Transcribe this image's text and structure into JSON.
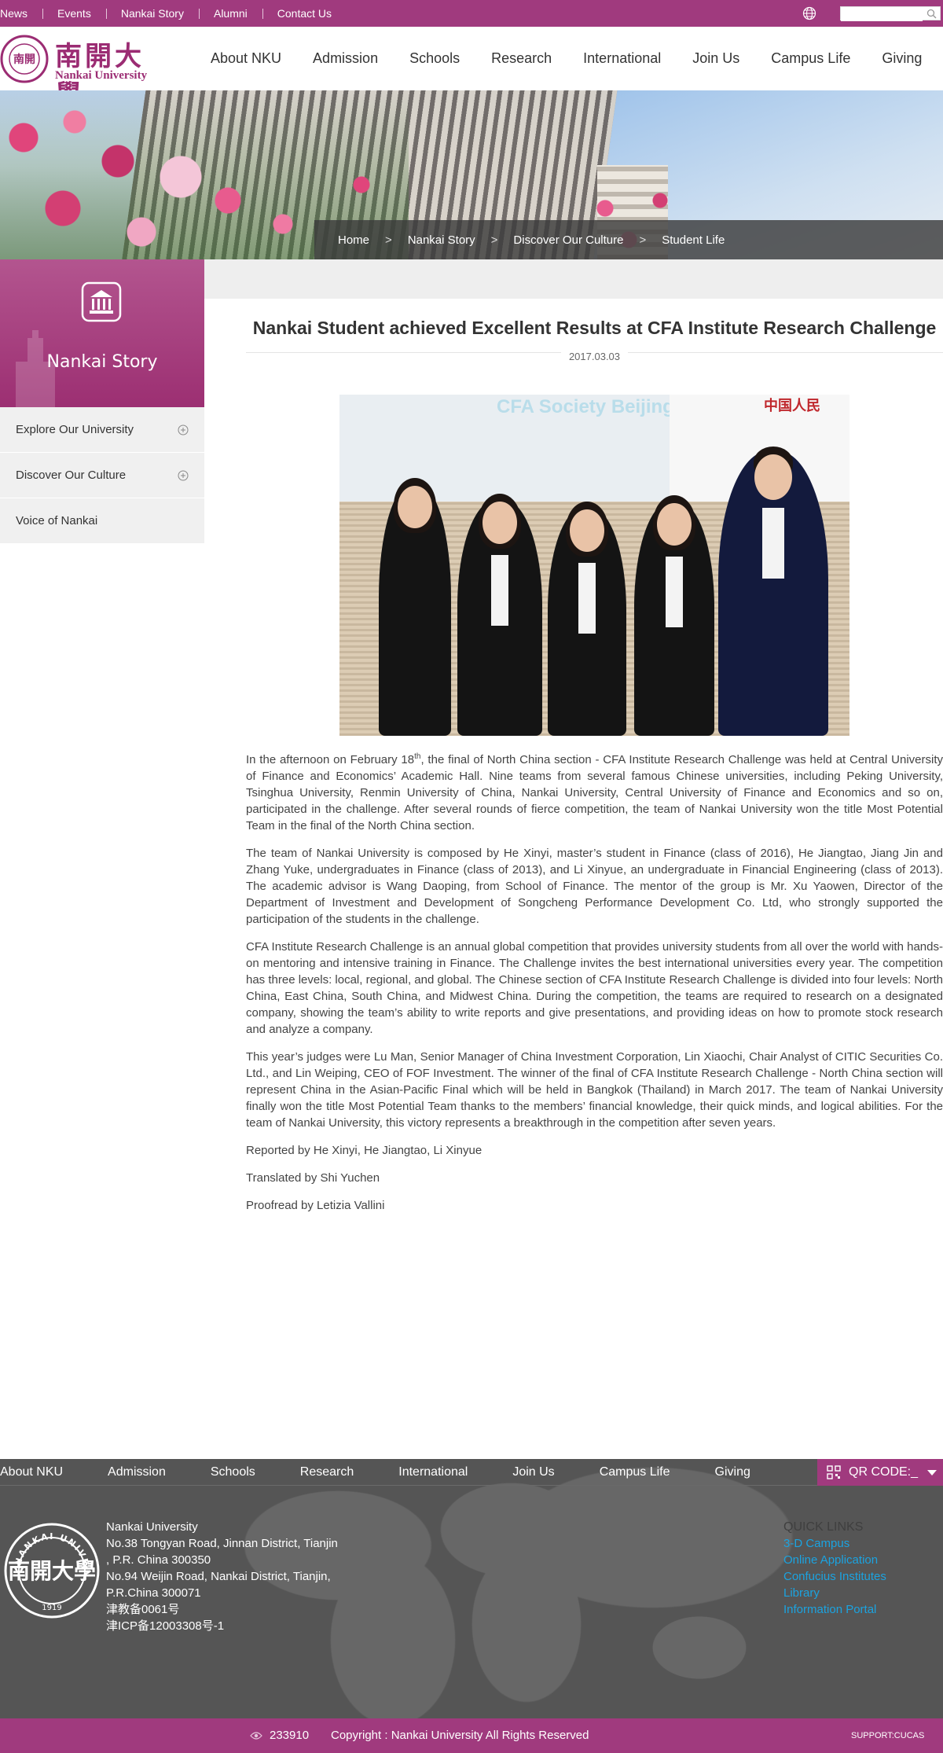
{
  "topbar": {
    "links": [
      "News",
      "Events",
      "Nankai Story",
      "Alumni",
      "Contact Us"
    ],
    "search_placeholder": ""
  },
  "logo": {
    "cn": "南開大學",
    "en": "Nankai University",
    "seal_text": "NANKAI UNIVERSITY",
    "seal_year": "1919"
  },
  "mainnav": [
    "About NKU",
    "Admission",
    "Schools",
    "Research",
    "International",
    "Join Us",
    "Campus Life",
    "Giving"
  ],
  "breadcrumb": [
    "Home",
    "Nankai Story",
    "Discover Our Culture",
    "Student Life"
  ],
  "breadcrumb_sep": ">",
  "sidebar": {
    "title": "Nankai Story",
    "items": [
      {
        "label": "Explore Our University",
        "icon": "plus-circle-icon"
      },
      {
        "label": "Discover Our Culture",
        "icon": "plus-circle-icon"
      },
      {
        "label": "Voice of Nankai"
      }
    ]
  },
  "article": {
    "title": "Nankai Student achieved Excellent Results at CFA Institute Research Challenge",
    "date": "2017.03.03",
    "photo_backdrop_text": "CFA Society Beijing",
    "photo_logo_text": "中国人民",
    "p1_pre": "In the afternoon on February 18",
    "p1_sup": "th",
    "p1_post": ", the final of North China section - CFA Institute Research Challenge was held at Central University of Finance and Economics’ Academic Hall. Nine teams from several famous Chinese universities, including Peking University, Tsinghua University, Renmin University of China, Nankai University, Central University of Finance and Economics and so on, participated in the challenge. After several rounds of fierce competition, the team of Nankai University won the title Most Potential Team in the final of the North China section.",
    "p2": "The team of Nankai University is composed by He Xinyi, master’s student in Finance (class of 2016), He Jiangtao, Jiang Jin and Zhang Yuke, undergraduates in Finance (class of 2013), and Li Xinyue, an undergraduate in Financial Engineering (class of 2013). The academic advisor is Wang Daoping, from School of Finance. The mentor of the group is Mr. Xu Yaowen, Director of the Department of Investment and Development of Songcheng Performance Development Co. Ltd, who strongly supported the participation of the students in the challenge.",
    "p3": "CFA Institute Research Challenge is an annual global competition that provides university students from all over the world with hands-on mentoring and intensive training in Finance. The Challenge invites the best international universities every year. The competition has three levels: local, regional, and global. The Chinese section of CFA Institute Research Challenge is divided into four levels: North China, East China, South China, and Midwest China. During the competition, the teams are required to research on a designated company, showing the team’s ability to write reports and give presentations, and providing ideas on how to promote stock research and analyze a company.",
    "p4": "This year’s judges were Lu Man, Senior Manager of China Investment Corporation, Lin Xiaochi, Chair Analyst of CITIC Securities Co. Ltd., and Lin Weiping, CEO of FOF Investment. The winner of the final of CFA Institute Research Challenge - North China section will represent China in the Asian-Pacific Final which will be held in Bangkok (Thailand) in March 2017. The team of Nankai University finally won the title Most Potential Team thanks to the members’ financial knowledge, their quick minds, and logical abilities. For the team of Nankai University, this victory represents a breakthrough in the competition after seven years.",
    "reported": "Reported by He Xinyi, He Jiangtao, Li Xinyue",
    "translated": "Translated by Shi Yuchen",
    "proofread": "Proofread by Letizia Vallini"
  },
  "footer": {
    "nav": [
      "About NKU",
      "Admission",
      "Schools",
      "Research",
      "International",
      "Join Us",
      "Campus Life",
      "Giving"
    ],
    "qr_label": "QR CODE:_",
    "address": [
      "Nankai University",
      "No.38 Tongyan Road, Jinnan District, Tianjin",
      ", P.R. China 300350",
      "No.94 Weijin Road,  Nankai District, Tianjin,",
      "P.R.China  300071",
      "津教备0061号",
      "津ICP备12003308号-1"
    ],
    "quick_title": "QUICK LINKS",
    "quick_links": [
      "3-D Campus",
      "Online Application",
      "Confucius Institutes",
      "Library",
      "Information Portal"
    ],
    "visits": "233910",
    "copyright": "Copyright : Nankai University All Rights Reserved",
    "support": "SUPPORT:CUCAS"
  },
  "colors": {
    "brand": "#a03a7e",
    "footer": "#555555",
    "link": "#1ba3e0"
  }
}
